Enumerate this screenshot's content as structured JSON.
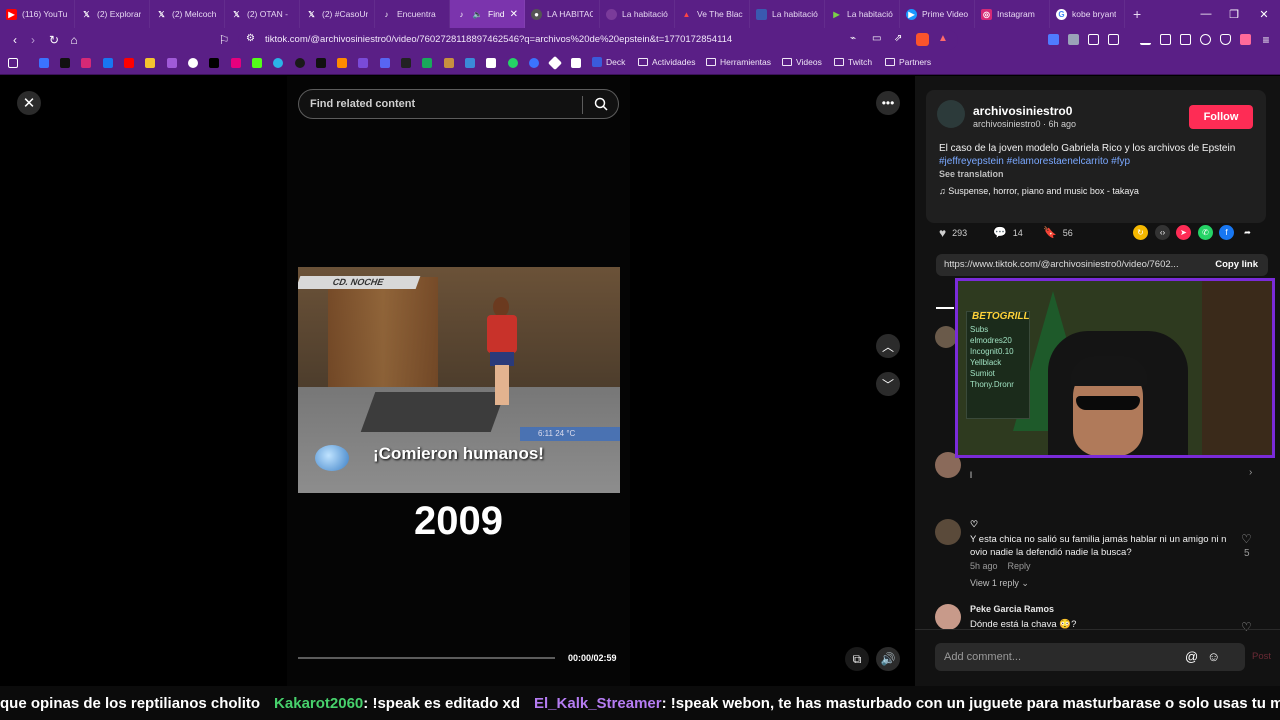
{
  "browser": {
    "tabs": [
      {
        "label": "(116) YouTu",
        "icon": "youtube-icon",
        "color": "#ff0000"
      },
      {
        "label": "(2) Explorar",
        "icon": "x-icon",
        "color": "#000000"
      },
      {
        "label": "(2) Melcoch",
        "icon": "x-icon",
        "color": "#000000"
      },
      {
        "label": "(2) OTAN -",
        "icon": "x-icon",
        "color": "#000000"
      },
      {
        "label": "(2) #CasoUr",
        "icon": "x-icon",
        "color": "#000000"
      },
      {
        "label": "Encuentra",
        "icon": "tiktok-icon",
        "color": "#111111"
      },
      {
        "label": "Find",
        "icon": "tiktok-icon",
        "color": "#111111",
        "active": true
      },
      {
        "label": "LA HABITAC",
        "icon": "globe-icon",
        "color": "#555555"
      },
      {
        "label": "La habitació",
        "icon": "globe-icon",
        "color": "#555555"
      },
      {
        "label": "Ve The Blac",
        "icon": "globe-icon",
        "color": "#cc2222"
      },
      {
        "label": "La habitació",
        "icon": "globe-icon",
        "color": "#3a5ab0"
      },
      {
        "label": "La habitació",
        "icon": "globe-icon",
        "color": "#4a8a2a"
      },
      {
        "label": "Prime Video",
        "icon": "prime-video-icon",
        "color": "#1a98ff"
      },
      {
        "label": "Instagram",
        "icon": "instagram-icon",
        "color": "#d62976"
      },
      {
        "label": "kobe bryant",
        "icon": "google-icon",
        "color": "#ffffff"
      }
    ],
    "url": "tiktok.com/@archivosiniestro0/video/7602728118897462546?q=archivos%20de%20epstein&t=1770172854114",
    "bookmarks": [
      {
        "label": "Deck"
      },
      {
        "label": "Actividades"
      },
      {
        "label": "Herramientas"
      },
      {
        "label": "Videos"
      },
      {
        "label": "Twitch"
      },
      {
        "label": "Partners"
      }
    ]
  },
  "player": {
    "search_placeholder": "Find related content",
    "logo_text": "CD. NOCHE",
    "caption": "¡Comieron humanos!",
    "temp_text": "6:11  24 °C",
    "year": "2009",
    "time": "00:00/02:59",
    "progress": 0.0
  },
  "post": {
    "username": "archivosiniestro0",
    "subline": "archivosiniestro0 · 6h ago",
    "follow_label": "Follow",
    "desc_text": "El caso de la joven modelo Gabriela Rico y los archivos de Epstein ",
    "hashtags": "#jeffreyepstein #elamorestaenelcarrito #fyp",
    "see_translation": "See translation",
    "music": "Suspense, horror, piano and music box - takaya",
    "likes": "293",
    "comments": "14",
    "saves": "56",
    "link": "https://www.tiktok.com/@archivosiniestro0/video/7602...",
    "copy_link": "Copy link"
  },
  "webcam": {
    "brand": "BETOGRILL",
    "board_lines": [
      "Subs",
      "elmodres20",
      "Incognit0.10",
      "Yellblack",
      "Sumiot",
      "Thony.Dronr"
    ]
  },
  "comments": [
    {
      "name": "",
      "text": "Y esta chica no salió su familia jamás hablar ni un amigo ni n ovio nadie la defendió nadie la busca?",
      "time": "5h ago",
      "reply": "Reply",
      "likes": "5",
      "view_replies": "View 1 reply"
    },
    {
      "name": "Peke Garcia Ramos",
      "text": "Dónde está la chava 😳?"
    }
  ],
  "comment_placeholder": "Add comment...",
  "post_label": "Post",
  "chat": [
    {
      "user": "",
      "text": "que opinas de los reptilianos cholito"
    },
    {
      "user": "Kakarot2060",
      "text": ": !speak es editado xd"
    },
    {
      "user": "El_Kalk_Streamer",
      "text": ": !speak webon, te has masturbado con un juguete para masturbarase o solo usas tu mano?"
    }
  ]
}
